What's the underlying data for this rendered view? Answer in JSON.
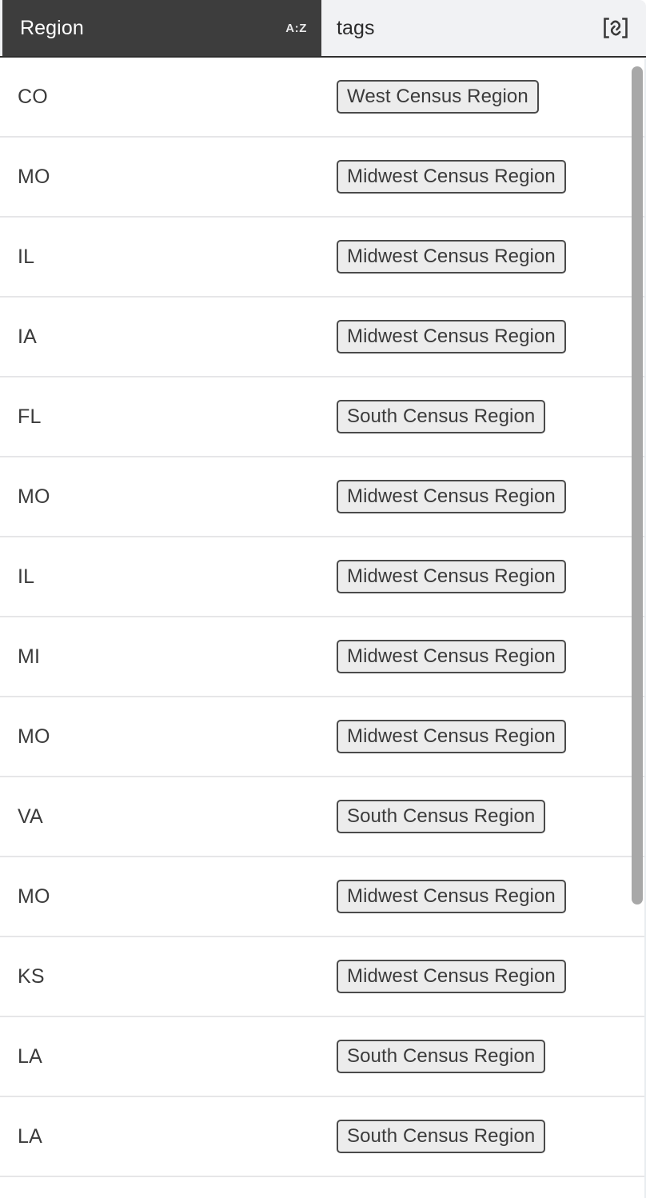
{
  "table": {
    "columns": [
      {
        "key": "region",
        "label": "Region",
        "sort_indicator": "A:Z",
        "icon": "",
        "selected": true
      },
      {
        "key": "tags",
        "label": "tags",
        "sort_indicator": "",
        "icon": "link-brackets-icon",
        "selected": false
      }
    ],
    "rows": [
      {
        "region": "CO",
        "tag": "West Census Region"
      },
      {
        "region": "MO",
        "tag": "Midwest Census Region"
      },
      {
        "region": "IL",
        "tag": "Midwest Census Region"
      },
      {
        "region": "IA",
        "tag": "Midwest Census Region"
      },
      {
        "region": "FL",
        "tag": "South Census Region"
      },
      {
        "region": "MO",
        "tag": "Midwest Census Region"
      },
      {
        "region": "IL",
        "tag": "Midwest Census Region"
      },
      {
        "region": "MI",
        "tag": "Midwest Census Region"
      },
      {
        "region": "MO",
        "tag": "Midwest Census Region"
      },
      {
        "region": "VA",
        "tag": "South Census Region"
      },
      {
        "region": "MO",
        "tag": "Midwest Census Region"
      },
      {
        "region": "KS",
        "tag": "Midwest Census Region"
      },
      {
        "region": "LA",
        "tag": "South Census Region"
      },
      {
        "region": "LA",
        "tag": "South Census Region"
      }
    ]
  },
  "colors": {
    "header_selected_bg": "#3d3d3d",
    "header_selected_text": "#ffffff",
    "header_bg": "#f1f2f4",
    "header_text": "#2b2b2b",
    "row_bg": "#ffffff",
    "row_divider": "#e6e6e8",
    "cell_text": "#3b3b3b",
    "tag_bg": "#ececec",
    "tag_border": "#4a4a4a",
    "scrollbar_thumb": "#a8a8a8"
  }
}
